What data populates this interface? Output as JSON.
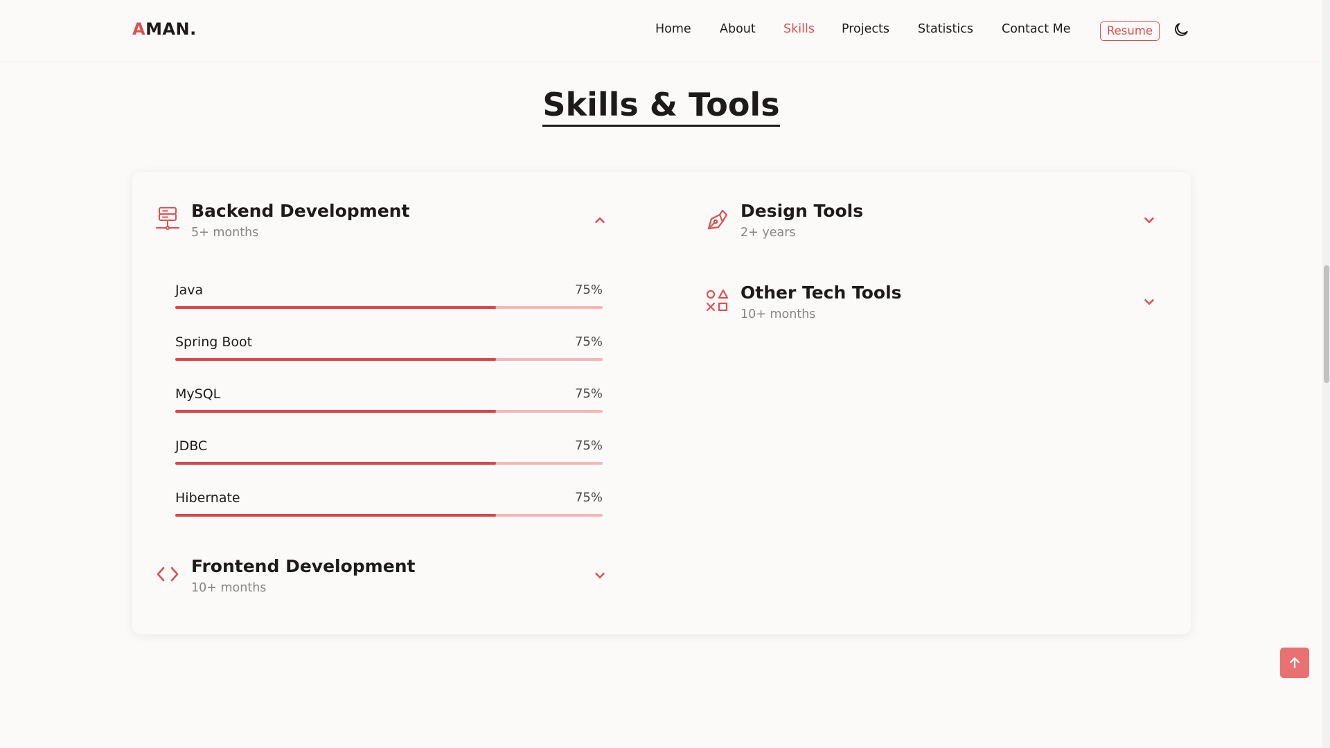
{
  "header": {
    "logo_accent": "A",
    "logo_rest": "MAN.",
    "nav": [
      "Home",
      "About",
      "Skills",
      "Projects",
      "Statistics",
      "Contact Me"
    ],
    "active_nav": "Skills",
    "resume_label": "Resume",
    "theme_icon": "moon-icon"
  },
  "section": {
    "title": "Skills & Tools"
  },
  "categories": {
    "backend": {
      "title": "Backend Development",
      "subtitle": "5+ months",
      "icon": "server-icon",
      "expanded": true,
      "skills": [
        {
          "name": "Java",
          "percent": "75%",
          "level": 75
        },
        {
          "name": "Spring Boot",
          "percent": "75%",
          "level": 75
        },
        {
          "name": "MySQL",
          "percent": "75%",
          "level": 75
        },
        {
          "name": "JDBC",
          "percent": "75%",
          "level": 75
        },
        {
          "name": "Hibernate",
          "percent": "75%",
          "level": 75
        }
      ]
    },
    "frontend": {
      "title": "Frontend Development",
      "subtitle": "10+ months",
      "icon": "code-icon",
      "expanded": false
    },
    "design": {
      "title": "Design Tools",
      "subtitle": "2+ years",
      "icon": "pen-tool-icon",
      "expanded": false
    },
    "other": {
      "title": "Other Tech Tools",
      "subtitle": "10+ months",
      "icon": "shapes-icon",
      "expanded": false
    }
  },
  "colors": {
    "accent": "#de4f52",
    "bar_track": "#f3b7b8",
    "background": "#fcfaf9"
  }
}
